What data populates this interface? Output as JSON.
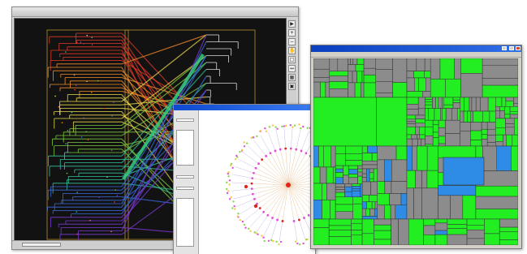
{
  "screens": {
    "tree_comparison": {
      "title": "",
      "status_left": "",
      "status_right": "",
      "toolbar_icons": [
        "pointer-icon",
        "zoom-in-icon",
        "zoom-out-icon",
        "pan-icon",
        "select-icon",
        "link-icon",
        "grid-icon",
        "fit-icon"
      ],
      "colors": {
        "background": "#121212",
        "branches": [
          "#e03a2a",
          "#f08a2a",
          "#e8d84a",
          "#7ac83c",
          "#33c29a",
          "#3a6ae0",
          "#7a3ad0",
          "#d9d9d9"
        ]
      }
    },
    "radial_tree": {
      "title": "",
      "panel_labels": [
        "",
        "",
        "",
        "",
        ""
      ],
      "colors": {
        "root": "#e0261c",
        "primary_leaf": "#e04fd8",
        "secondary_leaf": "#f5c842",
        "tertiary_leaf": "#8ad64a"
      }
    },
    "treemap": {
      "title": "",
      "menu": [
        "",
        "",
        ""
      ],
      "colors": {
        "green": "#22ee22",
        "gray": "#8c8c8c",
        "blue": "#2f8ce6",
        "border": "#333333"
      }
    }
  }
}
